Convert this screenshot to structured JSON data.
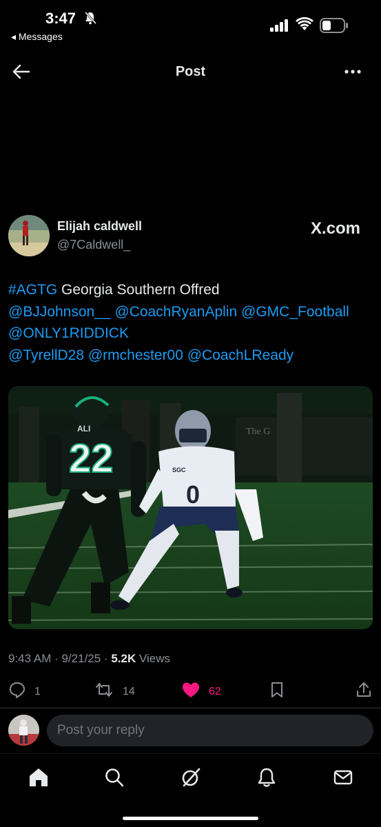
{
  "status_bar": {
    "time": "3:47",
    "back_app": "◂ Messages"
  },
  "header": {
    "title": "Post"
  },
  "author": {
    "name": "Elijah caldwell",
    "handle": "@7Caldwell_",
    "source": "X.com"
  },
  "tweet": {
    "lines": [
      [
        {
          "text": "#AGTG",
          "link": true
        },
        {
          "text": " Georgia Southern Offred",
          "link": false
        }
      ],
      [
        {
          "text": "@BJJohnson__",
          "link": true
        },
        {
          "text": " ",
          "link": false
        },
        {
          "text": "@CoachRyanAplin",
          "link": true
        },
        {
          "text": " ",
          "link": false
        },
        {
          "text": "@GMC_Football",
          "link": true
        }
      ],
      [
        {
          "text": "@ONLY1RIDDICK",
          "link": true
        }
      ],
      [
        {
          "text": "@TyrellD28",
          "link": true
        },
        {
          "text": " ",
          "link": false
        },
        {
          "text": "@rmchester00",
          "link": true
        },
        {
          "text": " ",
          "link": false
        },
        {
          "text": "@CoachLReady",
          "link": true
        }
      ]
    ]
  },
  "photo": {
    "player_left_number": "22",
    "player_left_name": "ALI",
    "player_right_number": "0",
    "player_right_chest": "SGC"
  },
  "meta": {
    "time_date": "9:43 AM · 9/21/25 · ",
    "views_count": "5.2K",
    "views_label": " Views"
  },
  "actions": {
    "replies": "1",
    "reposts": "14",
    "likes": "62"
  },
  "reply": {
    "placeholder": "Post your reply"
  },
  "colors": {
    "accent": "#1d9bf0",
    "like": "#f91880",
    "background": "#000000",
    "muted": "#8b8f94"
  },
  "icons": [
    "back-arrow-icon",
    "more-icon",
    "reply-icon",
    "repost-icon",
    "heart-icon",
    "bookmark-icon",
    "share-icon",
    "home-icon",
    "search-icon",
    "grok-icon",
    "notifications-icon",
    "messages-icon"
  ]
}
